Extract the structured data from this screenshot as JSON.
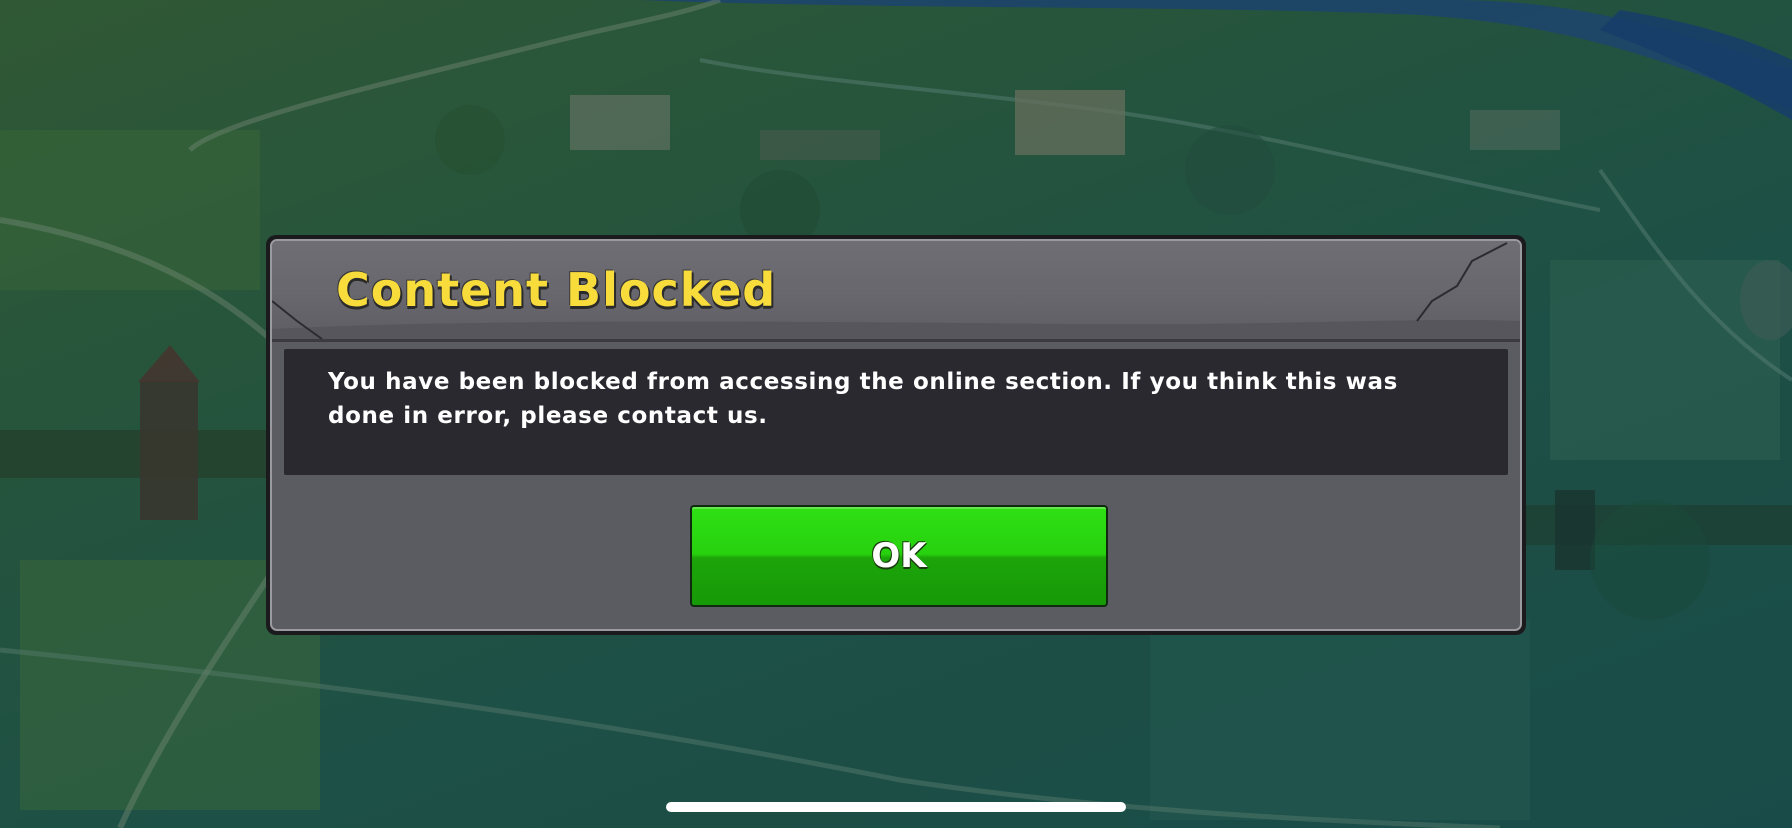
{
  "dialog": {
    "title": "Content Blocked",
    "message": "You have been blocked from accessing the online section. If you think this was done in error, please contact us.",
    "ok_label": "OK"
  },
  "colors": {
    "title_yellow": "#f7dc3c",
    "ok_green": "#27d10e",
    "panel_gray": "#5b5b62",
    "message_bg": "#2b2930"
  },
  "icons": {
    "background": "town-map-illustration",
    "home_indicator": "home-indicator-bar"
  }
}
